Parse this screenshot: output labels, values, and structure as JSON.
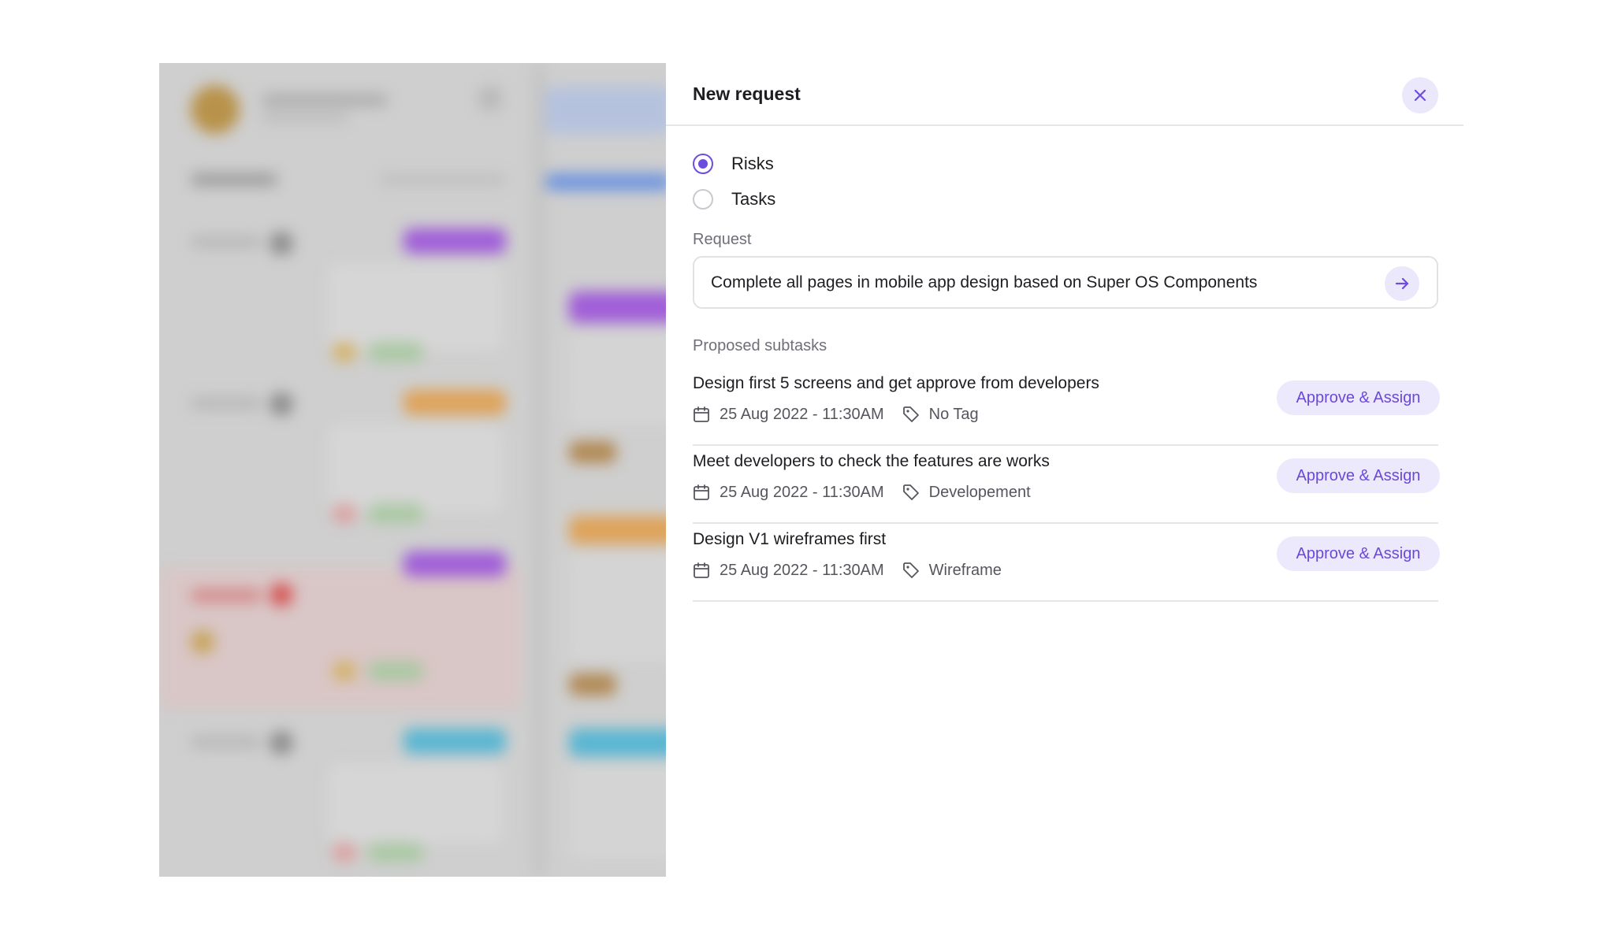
{
  "panel": {
    "title": "New request"
  },
  "request_type": {
    "options": [
      {
        "label": "Risks",
        "checked": true
      },
      {
        "label": "Tasks",
        "checked": false
      }
    ]
  },
  "request": {
    "label": "Request",
    "value": "Complete all pages in mobile app design based on Super OS Components"
  },
  "subtasks": {
    "label": "Proposed subtasks",
    "items": [
      {
        "title": "Design first 5 screens and get approve from developers",
        "date": "25 Aug 2022 - 11:30AM",
        "tag": "No Tag",
        "action": "Approve & Assign"
      },
      {
        "title": "Meet developers to check the features are works",
        "date": "25 Aug 2022 - 11:30AM",
        "tag": "Developement",
        "action": "Approve & Assign"
      },
      {
        "title": "Design V1 wireframes first",
        "date": "25 Aug 2022 - 11:30AM",
        "tag": "Wireframe",
        "action": "Approve & Assign"
      }
    ]
  },
  "icons": {
    "close": "close-icon",
    "send": "arrow-right-icon",
    "date": "calendar-icon",
    "tag": "tag-icon"
  },
  "colors": {
    "accent": "#6d4de0",
    "accent_soft": "#ece8fb",
    "backdrop": "#cfcfcf"
  }
}
